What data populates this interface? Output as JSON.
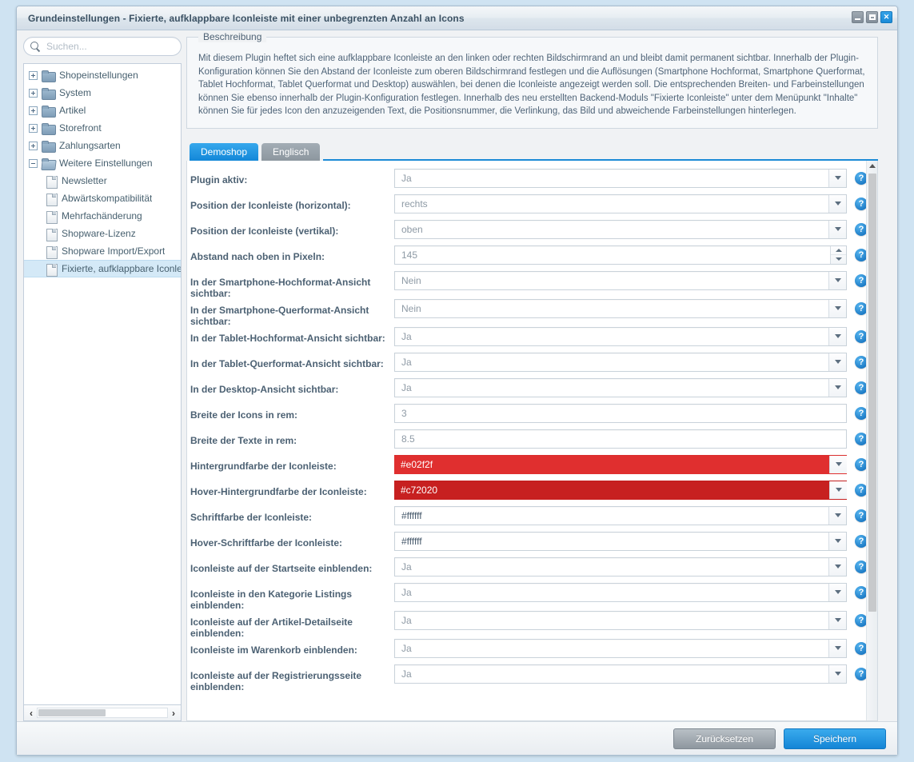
{
  "window": {
    "title": "Grundeinstellungen - Fixierte, aufklappbare Iconleiste mit einer unbegrenzten Anzahl an Icons",
    "controls": {
      "minimize": "minimize-button",
      "maximize": "maximize-button",
      "close": "✕"
    }
  },
  "sidebar": {
    "search": {
      "placeholder": "Suchen...",
      "value": ""
    },
    "tree": [
      {
        "label": "Shopeinstellungen",
        "type": "folder",
        "expanded": false,
        "selected": false
      },
      {
        "label": "System",
        "type": "folder",
        "expanded": false,
        "selected": false
      },
      {
        "label": "Artikel",
        "type": "folder",
        "expanded": false,
        "selected": false
      },
      {
        "label": "Storefront",
        "type": "folder",
        "expanded": false,
        "selected": false
      },
      {
        "label": "Zahlungsarten",
        "type": "folder",
        "expanded": false,
        "selected": false
      },
      {
        "label": "Weitere Einstellungen",
        "type": "folder",
        "expanded": true,
        "selected": false
      },
      {
        "label": "Newsletter",
        "type": "page",
        "child": true,
        "selected": false
      },
      {
        "label": "Abwärtskompatibilität",
        "type": "page",
        "child": true,
        "selected": false
      },
      {
        "label": "Mehrfachänderung",
        "type": "page",
        "child": true,
        "selected": false
      },
      {
        "label": "Shopware-Lizenz",
        "type": "page",
        "child": true,
        "selected": false
      },
      {
        "label": "Shopware Import/Export",
        "type": "page",
        "child": true,
        "selected": false
      },
      {
        "label": "Fixierte, aufklappbare Iconleiste",
        "type": "page",
        "child": true,
        "selected": true
      }
    ],
    "hscroll": {
      "left_arrow": "‹",
      "right_arrow": "›"
    }
  },
  "description": {
    "legend": "Beschreibung",
    "text": "Mit diesem Plugin heftet sich eine aufklappbare Iconleiste an den linken oder rechten Bildschirmrand an und bleibt damit permanent sichtbar. Innerhalb der Plugin-Konfiguration können Sie den Abstand der Iconleiste zum oberen Bildschirmrand festlegen und die Auflösungen (Smartphone Hochformat, Smartphone Querformat, Tablet Hochformat, Tablet Querformat und Desktop) auswählen, bei denen die Iconleiste angezeigt werden soll. Die entsprechenden Breiten- und Farbeinstellungen können Sie ebenso innerhalb der Plugin-Konfiguration festlegen. Innerhalb des neu erstellten Backend-Moduls \"Fixierte Iconleiste\" unter dem Menüpunkt \"Inhalte\" können Sie für jedes Icon den anzuzeigenden Text, die Positionsnummer, die Verlinkung, das Bild und abweichende Farbeinstellungen hinterlegen."
  },
  "tabs": [
    {
      "label": "Demoshop",
      "active": true
    },
    {
      "label": "Englisch",
      "active": false
    }
  ],
  "form": {
    "fields": [
      {
        "label": "Plugin aktiv:",
        "value": "Ja",
        "control": "select"
      },
      {
        "label": "Position der Iconleiste (horizontal):",
        "value": "rechts",
        "control": "select"
      },
      {
        "label": "Position der Iconleiste (vertikal):",
        "value": "oben",
        "control": "select"
      },
      {
        "label": "Abstand nach oben in Pixeln:",
        "value": "145",
        "control": "spinner"
      },
      {
        "label": "In der Smartphone-Hochformat-Ansicht sichtbar:",
        "value": "Nein",
        "control": "select"
      },
      {
        "label": "In der Smartphone-Querformat-Ansicht sichtbar:",
        "value": "Nein",
        "control": "select"
      },
      {
        "label": "In der Tablet-Hochformat-Ansicht sichtbar:",
        "value": "Ja",
        "control": "select"
      },
      {
        "label": "In der Tablet-Querformat-Ansicht sichtbar:",
        "value": "Ja",
        "control": "select"
      },
      {
        "label": "In der Desktop-Ansicht sichtbar:",
        "value": "Ja",
        "control": "select"
      },
      {
        "label": "Breite der Icons in rem:",
        "value": "3",
        "control": "text"
      },
      {
        "label": "Breite der Texte in rem:",
        "value": "8.5",
        "control": "text"
      },
      {
        "label": "Hintergrundfarbe der Iconleiste:",
        "value": "#e02f2f",
        "control": "color",
        "swatch": "#e02f2f"
      },
      {
        "label": "Hover-Hintergrundfarbe der Iconleiste:",
        "value": "#c72020",
        "control": "color",
        "swatch": "#c72020"
      },
      {
        "label": "Schriftfarbe der Iconleiste:",
        "value": "#ffffff",
        "control": "color",
        "swatch": "#ffffff"
      },
      {
        "label": "Hover-Schriftfarbe der Iconleiste:",
        "value": "#ffffff",
        "control": "color",
        "swatch": "#ffffff"
      },
      {
        "label": "Iconleiste auf der Startseite einblenden:",
        "value": "Ja",
        "control": "select"
      },
      {
        "label": "Iconleiste in den Kategorie Listings einblenden:",
        "value": "Ja",
        "control": "select"
      },
      {
        "label": "Iconleiste auf der Artikel-Detailseite einblenden:",
        "value": "Ja",
        "control": "select"
      },
      {
        "label": "Iconleiste im Warenkorb einblenden:",
        "value": "Ja",
        "control": "select"
      },
      {
        "label": "Iconleiste auf der Registrierungsseite einblenden:",
        "value": "Ja",
        "control": "select"
      }
    ],
    "help_glyph": "?"
  },
  "footer": {
    "reset_label": "Zurücksetzen",
    "save_label": "Speichern"
  },
  "colors": {
    "accent": "#1387d8",
    "bg_iconbar": "#e02f2f",
    "hover_bg_iconbar": "#c72020",
    "font_iconbar": "#ffffff"
  }
}
